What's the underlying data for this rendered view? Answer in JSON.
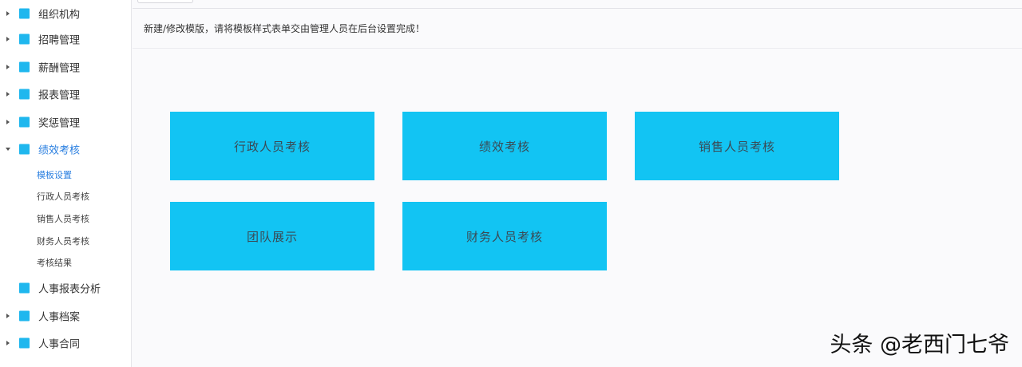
{
  "sidebar": {
    "items": [
      {
        "label": "组织机构"
      },
      {
        "label": "招聘管理"
      },
      {
        "label": "薪酬管理"
      },
      {
        "label": "报表管理"
      },
      {
        "label": "奖惩管理"
      },
      {
        "label": "绩效考核"
      },
      {
        "label": "人事报表分析"
      },
      {
        "label": "人事档案"
      },
      {
        "label": "人事合同"
      }
    ],
    "subitems": [
      {
        "label": "模板设置"
      },
      {
        "label": "行政人员考核"
      },
      {
        "label": "销售人员考核"
      },
      {
        "label": "财务人员考核"
      },
      {
        "label": "考核结果"
      }
    ]
  },
  "main": {
    "notice": "新建/修改模版，请将模板样式表单交由管理人员在后台设置完成！",
    "cards": [
      {
        "label": "行政人员考核"
      },
      {
        "label": "绩效考核"
      },
      {
        "label": "销售人员考核"
      },
      {
        "label": "团队展示"
      },
      {
        "label": "财务人员考核"
      }
    ]
  },
  "watermark": "头条 @老西门七爷",
  "colors": {
    "accent": "#12c4f3",
    "icon": "#1fb7ee",
    "active_text": "#2a7fe0"
  }
}
